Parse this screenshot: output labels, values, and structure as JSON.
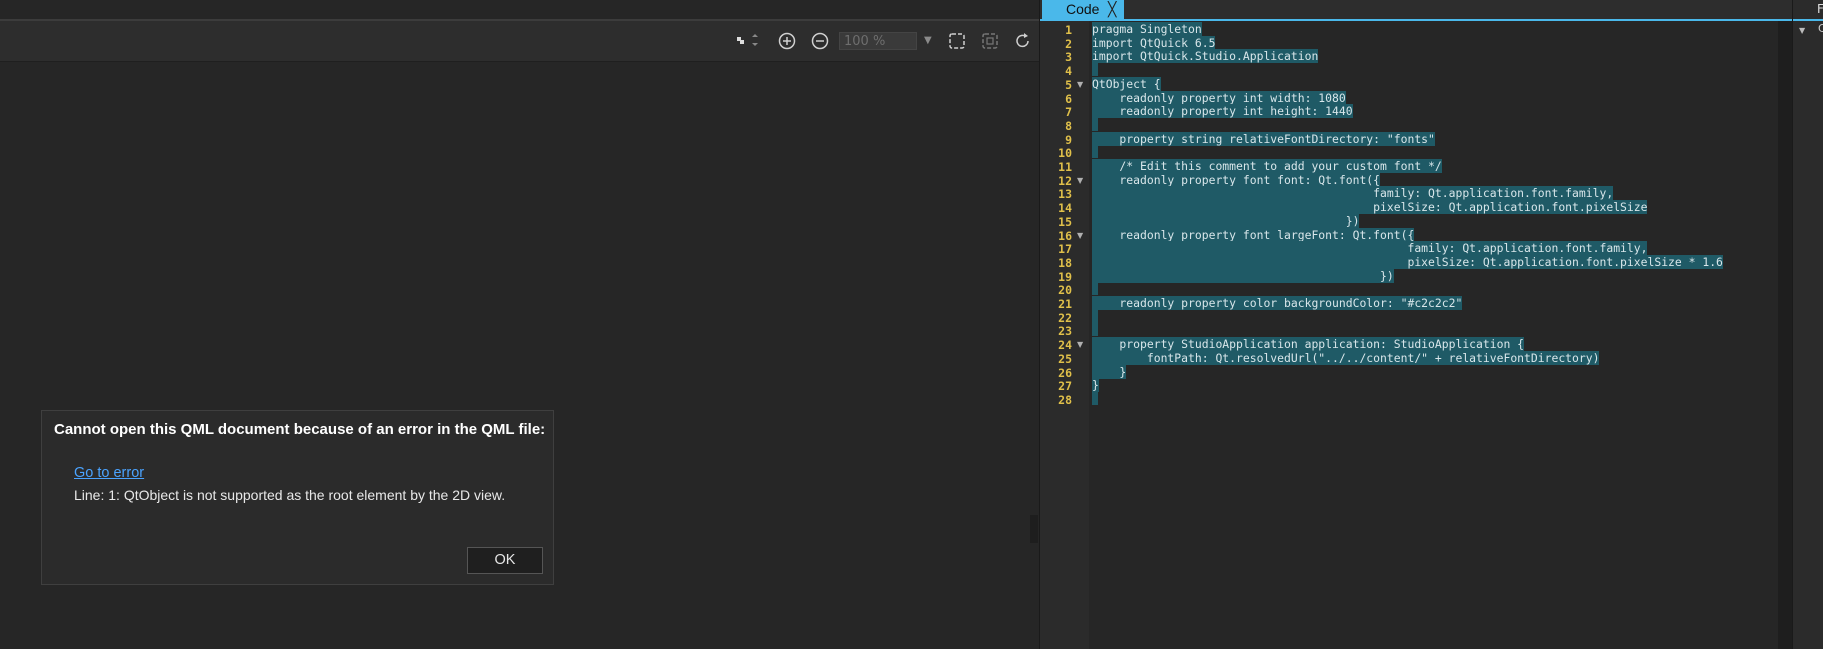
{
  "toolbar": {
    "zoom_value": "100 %",
    "icons": [
      "move-icon",
      "zoom-in-icon",
      "zoom-out-icon",
      "fit-selection-icon",
      "fit-all-icon",
      "reset-icon"
    ]
  },
  "dialog": {
    "title": "Cannot open this QML document because of an error in the QML file:",
    "link": "Go to error",
    "message": "Line: 1: QtObject is not supported as the root element by the 2D view.",
    "ok_label": "OK"
  },
  "editor": {
    "tab_label": "Code",
    "tab_close": "╳",
    "lines": [
      {
        "n": "1",
        "fold": "",
        "text": "pragma Singleton"
      },
      {
        "n": "2",
        "fold": "",
        "text": "import QtQuick 6.5"
      },
      {
        "n": "3",
        "fold": "",
        "text": "import QtQuick.Studio.Application"
      },
      {
        "n": "4",
        "fold": "",
        "text": ""
      },
      {
        "n": "5",
        "fold": "▼",
        "text": "QtObject {"
      },
      {
        "n": "6",
        "fold": "",
        "text": "    readonly property int width: 1080"
      },
      {
        "n": "7",
        "fold": "",
        "text": "    readonly property int height: 1440"
      },
      {
        "n": "8",
        "fold": "",
        "text": ""
      },
      {
        "n": "9",
        "fold": "",
        "text": "    property string relativeFontDirectory: \"fonts\""
      },
      {
        "n": "10",
        "fold": "",
        "text": ""
      },
      {
        "n": "11",
        "fold": "",
        "text": "    /* Edit this comment to add your custom font */"
      },
      {
        "n": "12",
        "fold": "▼",
        "text": "    readonly property font font: Qt.font({"
      },
      {
        "n": "13",
        "fold": "",
        "text": "                                         family: Qt.application.font.family,"
      },
      {
        "n": "14",
        "fold": "",
        "text": "                                         pixelSize: Qt.application.font.pixelSize"
      },
      {
        "n": "15",
        "fold": "",
        "text": "                                     })"
      },
      {
        "n": "16",
        "fold": "▼",
        "text": "    readonly property font largeFont: Qt.font({"
      },
      {
        "n": "17",
        "fold": "",
        "text": "                                              family: Qt.application.font.family,"
      },
      {
        "n": "18",
        "fold": "",
        "text": "                                              pixelSize: Qt.application.font.pixelSize * 1.6"
      },
      {
        "n": "19",
        "fold": "",
        "text": "                                          })"
      },
      {
        "n": "20",
        "fold": "",
        "text": ""
      },
      {
        "n": "21",
        "fold": "",
        "text": "    readonly property color backgroundColor: \"#c2c2c2\""
      },
      {
        "n": "22",
        "fold": "",
        "text": ""
      },
      {
        "n": "23",
        "fold": "",
        "text": ""
      },
      {
        "n": "24",
        "fold": "▼",
        "text": "    property StudioApplication application: StudioApplication {"
      },
      {
        "n": "25",
        "fold": "",
        "text": "        fontPath: Qt.resolvedUrl(\"../../content/\" + relativeFontDirectory)"
      },
      {
        "n": "26",
        "fold": "",
        "text": "    }"
      },
      {
        "n": "27",
        "fold": "",
        "text": "}"
      },
      {
        "n": "28",
        "fold": "",
        "text": ""
      }
    ]
  },
  "right_panel": {
    "header_label": "F",
    "row_label": "C"
  },
  "colors": {
    "accent": "#4ab8ea",
    "selection": "#1f5a66",
    "line_numbers": "#e0c04a",
    "link": "#4aa3ff"
  }
}
